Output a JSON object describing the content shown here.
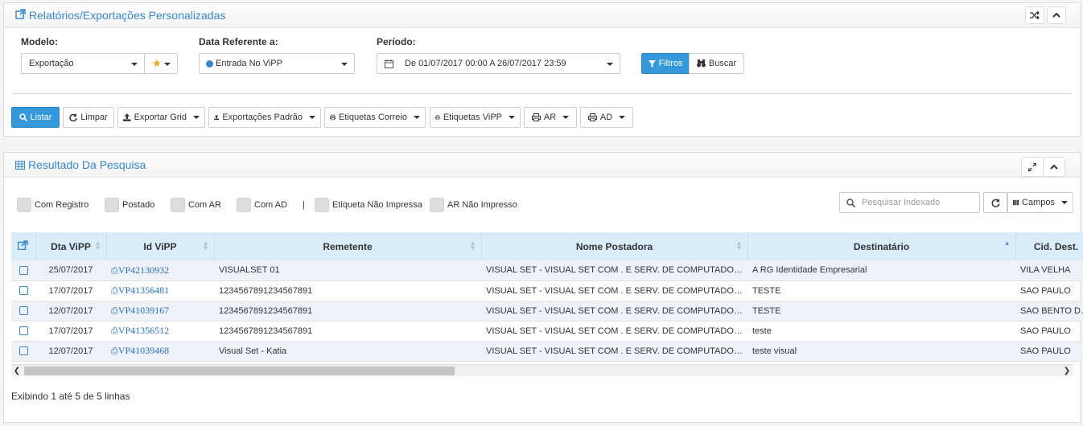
{
  "report_panel": {
    "title": "Relatórios/Exportações Personalizadas",
    "modelo_label": "Modelo:",
    "modelo_value": "Exportação",
    "data_ref_label": "Data Referente a:",
    "data_ref_value": "Entrada No ViPP",
    "periodo_label": "Período:",
    "periodo_value": "De 01/07/2017 00:00 A 26/07/2017 23:59",
    "filtros_label": "Filtros",
    "buscar_label": "Buscar"
  },
  "toolbar": {
    "listar": "Listar",
    "limpar": "Limpar",
    "exportar_grid": "Exportar Grid",
    "exportacoes_padrao": "Exportações Padrão",
    "etiquetas_correio": "Etiquetas Correio",
    "etiquetas_vipp": "Etiquetas ViPP",
    "ar": "AR",
    "ad": "AD"
  },
  "results_panel": {
    "title": "Resultado Da Pesquisa",
    "filters": [
      "Com Registro",
      "Postado",
      "Com AR",
      "Com AD",
      "Etiqueta Não Impressa",
      "AR Não Impresso"
    ],
    "separator": "|",
    "search_placeholder": "Pesquisar Indexado",
    "campos_label": "Campos",
    "columns": [
      "Dta ViPP",
      "Id ViPP",
      "Remetente",
      "Nome Postadora",
      "Destinatário",
      "Cid. Dest."
    ],
    "rows": [
      {
        "date": "25/07/2017",
        "id": "VP42130932",
        "remetente": "VISUALSET 01",
        "postadora": "VISUAL SET - VISUAL SET COM . E SERV. DE COMPUTADORES",
        "destinatario": "A RG Identidade Empresarial",
        "cidade": "VILA VELHA"
      },
      {
        "date": "17/07/2017",
        "id": "VP41356481",
        "remetente": "1234567891234567891",
        "postadora": "VISUAL SET - VISUAL SET COM . E SERV. DE COMPUTADORES",
        "destinatario": "TESTE",
        "cidade": "SAO PAULO"
      },
      {
        "date": "12/07/2017",
        "id": "VP41039167",
        "remetente": "1234567891234567891",
        "postadora": "VISUAL SET - VISUAL SET COM . E SERV. DE COMPUTADORES",
        "destinatario": "TESTE",
        "cidade": "SAO BENTO DO ..."
      },
      {
        "date": "17/07/2017",
        "id": "VP41356512",
        "remetente": "1234567891234567891",
        "postadora": "VISUAL SET - VISUAL SET COM . E SERV. DE COMPUTADORES",
        "destinatario": "teste",
        "cidade": "SAO PAULO"
      },
      {
        "date": "12/07/2017",
        "id": "VP41039468",
        "remetente": "Visual Set - Katia",
        "postadora": "VISUAL SET - VISUAL SET COM . E SERV. DE COMPUTADORES",
        "destinatario": "teste visual",
        "cidade": "SAO PAULO"
      }
    ],
    "footer": "Exibindo 1 até 5 de 5 linhas"
  },
  "colors": {
    "accent": "#3498db",
    "title": "#3a87c8",
    "header_bg": "#d9ecf9",
    "row_alt": "#eef2f8"
  }
}
